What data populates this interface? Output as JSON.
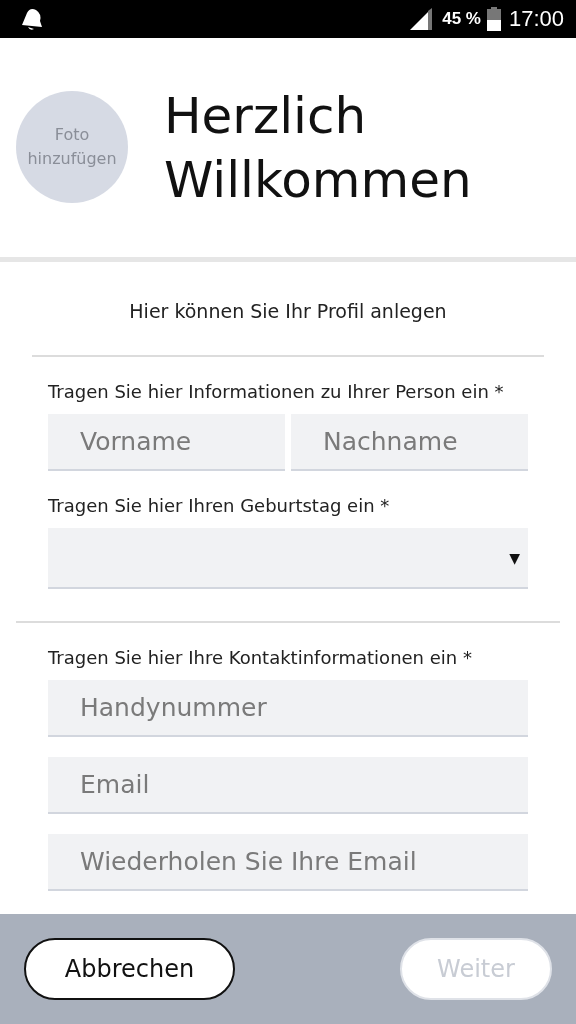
{
  "status_bar": {
    "battery": "45 %",
    "time": "17:00"
  },
  "header": {
    "photo_label": "Foto hinzufügen",
    "title": "Herzlich Willkommen"
  },
  "intro": "Hier können Sie Ihr Profil anlegen",
  "groups": [
    [
      {
        "label": "Tragen Sie hier Informationen zu Ihrer Person ein *",
        "rows": [
          [
            {
              "kind": "text",
              "placeholder": "Vorname"
            },
            {
              "kind": "text",
              "placeholder": "Nachname"
            }
          ]
        ]
      },
      {
        "label": "Tragen Sie hier Ihren Geburtstag ein *",
        "rows": [
          [
            {
              "kind": "select",
              "arrow": "▼"
            }
          ]
        ]
      }
    ],
    [
      {
        "label": "Tragen Sie hier Ihre Kontaktinformationen ein *",
        "rows": [
          [
            {
              "kind": "text",
              "placeholder": "Handynummer"
            }
          ],
          [
            {
              "kind": "text",
              "placeholder": "Email"
            }
          ],
          [
            {
              "kind": "text",
              "placeholder": "Wiederholen Sie Ihre Email"
            }
          ]
        ]
      }
    ]
  ],
  "footer": {
    "buttons": [
      {
        "label": "Abbrechen",
        "disabled": false
      },
      {
        "label": "Weiter",
        "disabled": true
      }
    ]
  }
}
